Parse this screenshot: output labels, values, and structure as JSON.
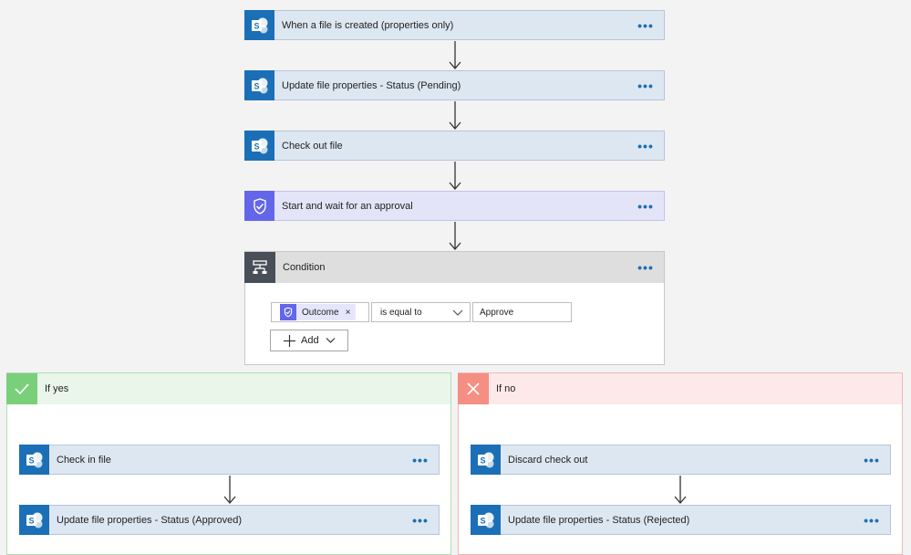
{
  "flow": {
    "steps": [
      {
        "label": "When a file is created (properties only)",
        "icon": "sharepoint-icon"
      },
      {
        "label": "Update file properties - Status (Pending)",
        "icon": "sharepoint-icon"
      },
      {
        "label": "Check out file",
        "icon": "sharepoint-icon"
      },
      {
        "label": "Start and wait for an approval",
        "icon": "approvals-icon"
      }
    ],
    "more_label": "•••"
  },
  "condition": {
    "title": "Condition",
    "token_label": "Outcome",
    "token_remove": "×",
    "operator": "is equal to",
    "value": "Approve",
    "add_label": "Add"
  },
  "if_yes": {
    "title": "If yes",
    "steps": [
      {
        "label": "Check in file",
        "icon": "sharepoint-icon"
      },
      {
        "label": "Update file properties - Status (Approved)",
        "icon": "sharepoint-icon"
      }
    ]
  },
  "if_no": {
    "title": "If no",
    "steps": [
      {
        "label": "Discard check out",
        "icon": "sharepoint-icon"
      },
      {
        "label": "Update file properties - Status (Rejected)",
        "icon": "sharepoint-icon"
      }
    ]
  },
  "colors": {
    "sharepoint": "#1b6fb7",
    "approvals": "#6366e8",
    "condition_icon": "#484f58",
    "yes": "#7ad07a",
    "no": "#f58f84"
  }
}
